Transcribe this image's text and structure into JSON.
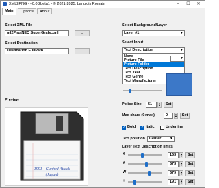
{
  "window": {
    "title": "XML2PNG - v0.0.2beta1 - © 2021-2025, Langlois Romain",
    "minimize": "–",
    "maximize": "☐",
    "close": "✕"
  },
  "tabs": [
    {
      "label": "Main"
    },
    {
      "label": "Options"
    },
    {
      "label": "About"
    }
  ],
  "left": {
    "xml_label": "Select XML File",
    "xml_value": "ml2Png\\NEC SuperGrafx.xml",
    "browse_label": "...",
    "dest_label": "Select Destination",
    "dest_value": "Destination FullPath",
    "preview_label": "Preview",
    "disk_label_line1": "1991 - Gunhed Attack",
    "disk_label_line2": "(Japan)"
  },
  "right": {
    "bg_layer_label": "Select Background\\Layer",
    "layer_value": "Layer #1",
    "input_label": "Select Input",
    "input_value": "Text Description",
    "input_options": [
      "None",
      "Picture File",
      "Picture Folder",
      "Text Description",
      "Text Year",
      "Text Genre",
      "Text Manufacturer"
    ],
    "input_selected_index": 2,
    "police_label": "Police Size",
    "police_value": "51",
    "set_label": "Set",
    "maxchars_label": "Max chars (0:max)",
    "maxchars_value": "0",
    "bold_label": "Bold",
    "bold_checked": true,
    "italic_label": "Italic",
    "italic_checked": true,
    "underline_label": "Underline",
    "underline_checked": false,
    "textpos_label": "Text position",
    "textpos_value": "Center",
    "limits_label": "Layer Text Description limits",
    "limits": [
      {
        "axis": "X",
        "value": "163",
        "set": "Set"
      },
      {
        "axis": "Y",
        "value": "573",
        "set": "Set"
      },
      {
        "axis": "W",
        "value": "679",
        "set": "Set"
      },
      {
        "axis": "H",
        "value": "191",
        "set": "Set"
      }
    ],
    "color_value": "#3c78c8"
  }
}
